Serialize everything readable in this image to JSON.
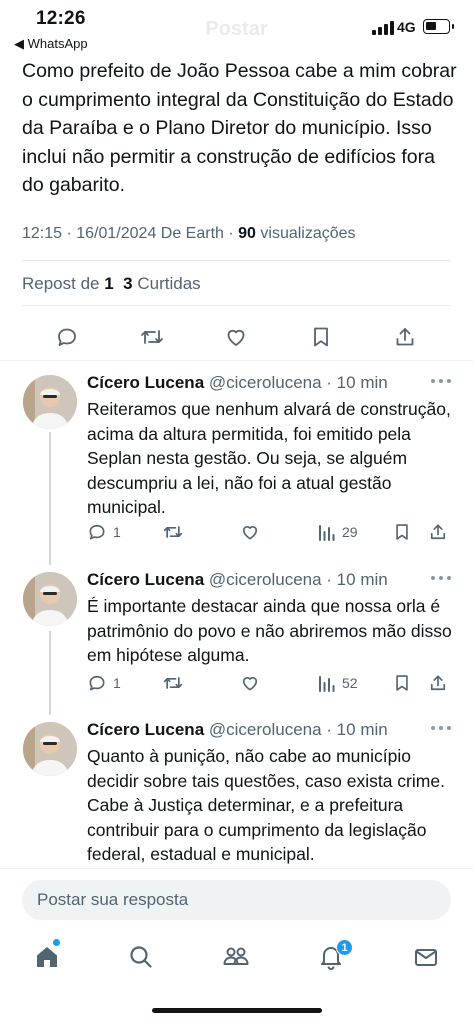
{
  "status_bar": {
    "time": "12:26",
    "back_app": "◀ WhatsApp",
    "network": "4G",
    "ghost_title": "Postar"
  },
  "main_post": {
    "text": "Como prefeito de João Pessoa cabe a mim cobrar o cumprimento integral da Constituição do Estado da Paraíba e o Plano Diretor do município. Isso inclui não permitir a construção de edifícios fora do gabarito.",
    "timestamp": "12:15 · 16/01/2024 De Earth · ",
    "views_count": "90",
    "views_label": " visualizações",
    "reposts_label": "Repost de ",
    "reposts_count": "1",
    "likes_count": "3",
    "likes_label": " Curtidas"
  },
  "replies": [
    {
      "name": "Cícero Lucena",
      "handle": " @cicerolucena · 10 min",
      "text": "Reiteramos que nenhum alvará de construção, acima da altura permitida, foi emitido pela Seplan nesta gestão. Ou seja, se alguém descumpriu a lei, não foi a atual gestão municipal.",
      "reply_count": "1",
      "views": "29"
    },
    {
      "name": "Cícero Lucena",
      "handle": " @cicerolucena · 10 min",
      "text": "É importante destacar ainda que nossa orla é patrimônio do povo e não abriremos mão disso em hipótese alguma.",
      "reply_count": "1",
      "views": "52"
    },
    {
      "name": "Cícero Lucena",
      "handle": " @cicerolucena · 10 min",
      "text": "Quanto à punição, não cabe ao município decidir sobre tais questões, caso exista crime. Cabe à Justiça determinar, e a prefeitura contribuir para o cumprimento da legislação federal, estadual e municipal."
    }
  ],
  "composer": {
    "placeholder": "Postar sua resposta"
  },
  "tabbar": {
    "notifications_badge": "1",
    "items": [
      "home-icon",
      "search-icon",
      "communities-icon",
      "notifications-icon",
      "messages-icon"
    ]
  },
  "colors": {
    "accent": "#1d9bf0",
    "text": "#0f1419",
    "muted": "#536471"
  }
}
